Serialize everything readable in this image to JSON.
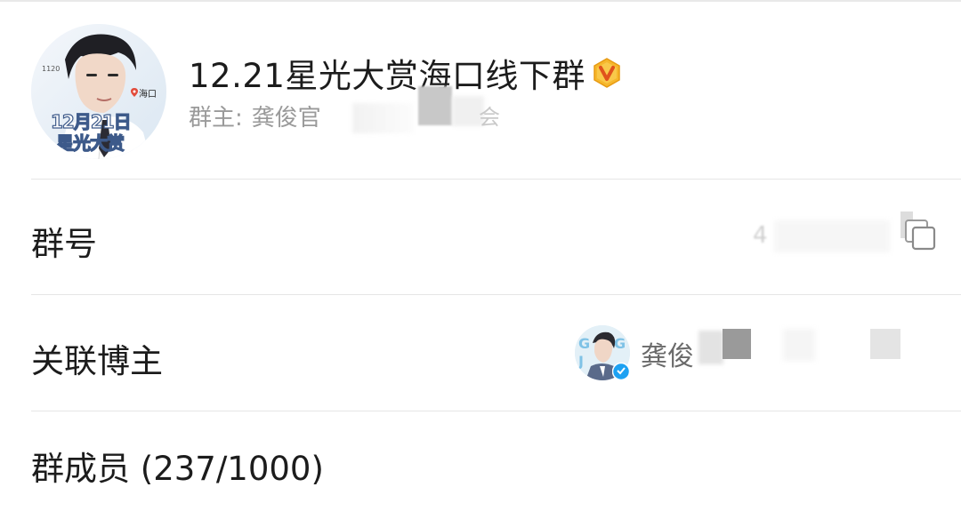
{
  "header": {
    "group_name": "12.21星光大赏海口线下群",
    "owner_label": "群主:",
    "owner_name": "龚俊官",
    "owner_name_tail": "会",
    "avatar_text_line1": "12月21日",
    "avatar_text_line2": "星光大赏",
    "avatar_location": "海口",
    "avatar_small_text": "1120"
  },
  "rows": {
    "group_id_label": "群号",
    "group_id_partial": "4",
    "blogger_label": "关联博主",
    "blogger_name": "龚俊",
    "members_label": "群成员 (237/1000)"
  },
  "colors": {
    "accent_badge": "#f5a623",
    "verified": "#1da1f2",
    "divider": "#e6e6e6",
    "secondary_text": "#9a9a9a"
  },
  "icons": {
    "vip_badge": "vip-badge-icon",
    "copy": "copy-icon",
    "verified": "verified-icon",
    "location_pin": "location-pin-icon"
  }
}
